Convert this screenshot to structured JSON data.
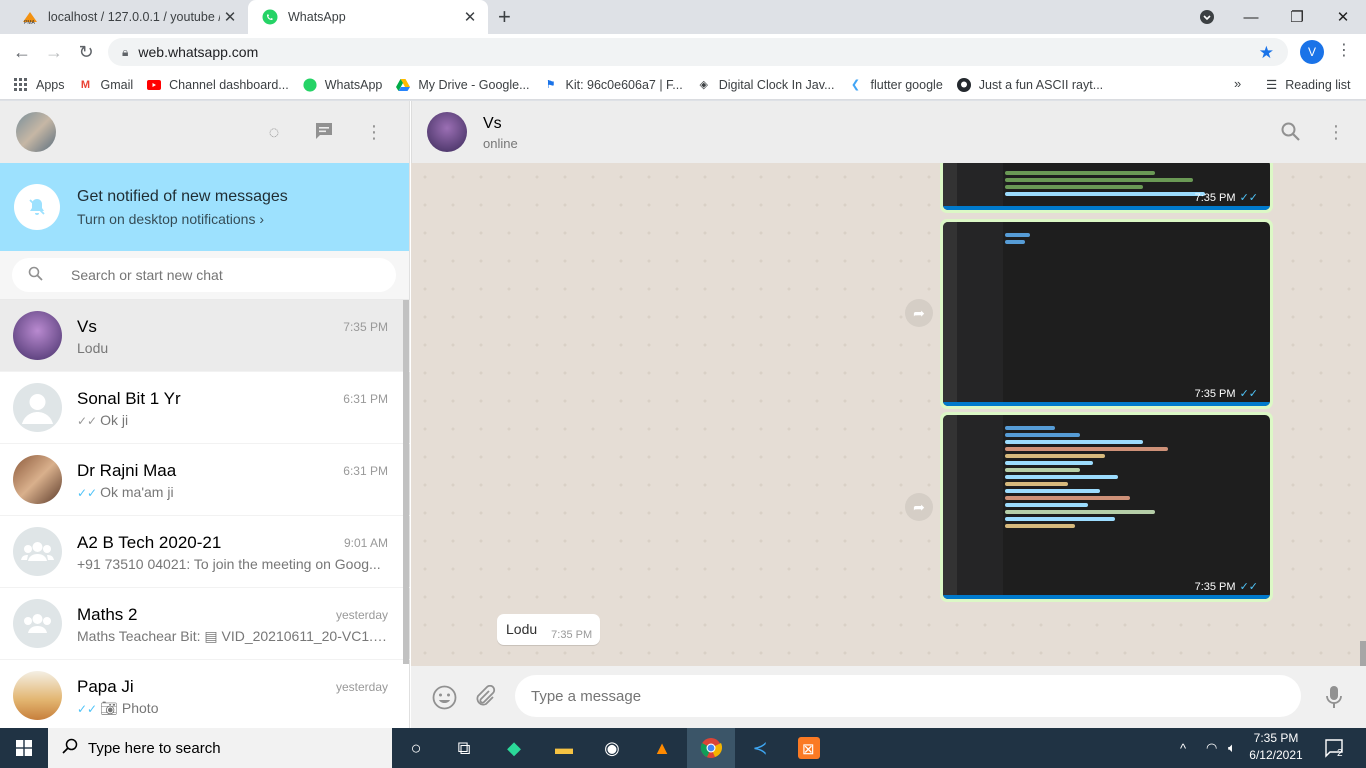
{
  "browser": {
    "tabs": [
      {
        "title": "localhost / 127.0.0.1 / youtube / |",
        "active": false
      },
      {
        "title": "WhatsApp",
        "active": true
      }
    ],
    "url": "web.whatsapp.com",
    "profile_initial": "V",
    "bookmarks": [
      {
        "label": "Apps",
        "icon": "apps-grid-icon"
      },
      {
        "label": "Gmail",
        "icon": "gmail-icon"
      },
      {
        "label": "Channel dashboard...",
        "icon": "youtube-icon"
      },
      {
        "label": "WhatsApp",
        "icon": "whatsapp-icon"
      },
      {
        "label": "My Drive - Google...",
        "icon": "google-drive-icon"
      },
      {
        "label": "Kit: 96c0e606a7 | F...",
        "icon": "flag-icon"
      },
      {
        "label": "Digital Clock In Jav...",
        "icon": "codepen-icon"
      },
      {
        "label": "flutter google",
        "icon": "flutter-icon"
      },
      {
        "label": "Just a fun ASCII rayt...",
        "icon": "github-icon"
      }
    ],
    "more": "»",
    "reading_list": "Reading list"
  },
  "sidebar": {
    "notify_title": "Get notified of new messages",
    "notify_sub": "Turn on desktop notifications ›",
    "search_placeholder": "Search or start new chat",
    "chats": [
      {
        "name": "Vs",
        "time": "7:35 PM",
        "message": "Lodu",
        "selected": true,
        "ticks": ""
      },
      {
        "name": "Sonal Bit 1 Yr",
        "time": "6:31 PM",
        "message": "Ok ji",
        "ticks": "grey"
      },
      {
        "name": "Dr Rajni Maa",
        "time": "6:31 PM",
        "message": "Ok ma'am ji",
        "ticks": "blue"
      },
      {
        "name": "A2 B Tech 2020-21",
        "time": "9:01 AM",
        "message": "+91 73510 04021: To join the meeting on Goog...",
        "ticks": ""
      },
      {
        "name": "Maths 2",
        "time": "yesterday",
        "message": "Maths Teachear Bit: ▤ VID_20210611_20-VC1.m...",
        "ticks": ""
      },
      {
        "name": "Papa Ji",
        "time": "yesterday",
        "message": "Photo",
        "ticks": "blue",
        "photo_icon": true
      }
    ]
  },
  "conversation": {
    "name": "Vs",
    "status": "online",
    "image_times": [
      "7:35 PM",
      "7:35 PM",
      "7:35 PM"
    ],
    "text_message": "Lodu",
    "text_time": "7:35 PM",
    "input_placeholder": "Type a message"
  },
  "taskbar": {
    "search_placeholder": "Type here to search",
    "time": "7:35 PM",
    "date": "6/12/2021",
    "notification_count": "2"
  }
}
